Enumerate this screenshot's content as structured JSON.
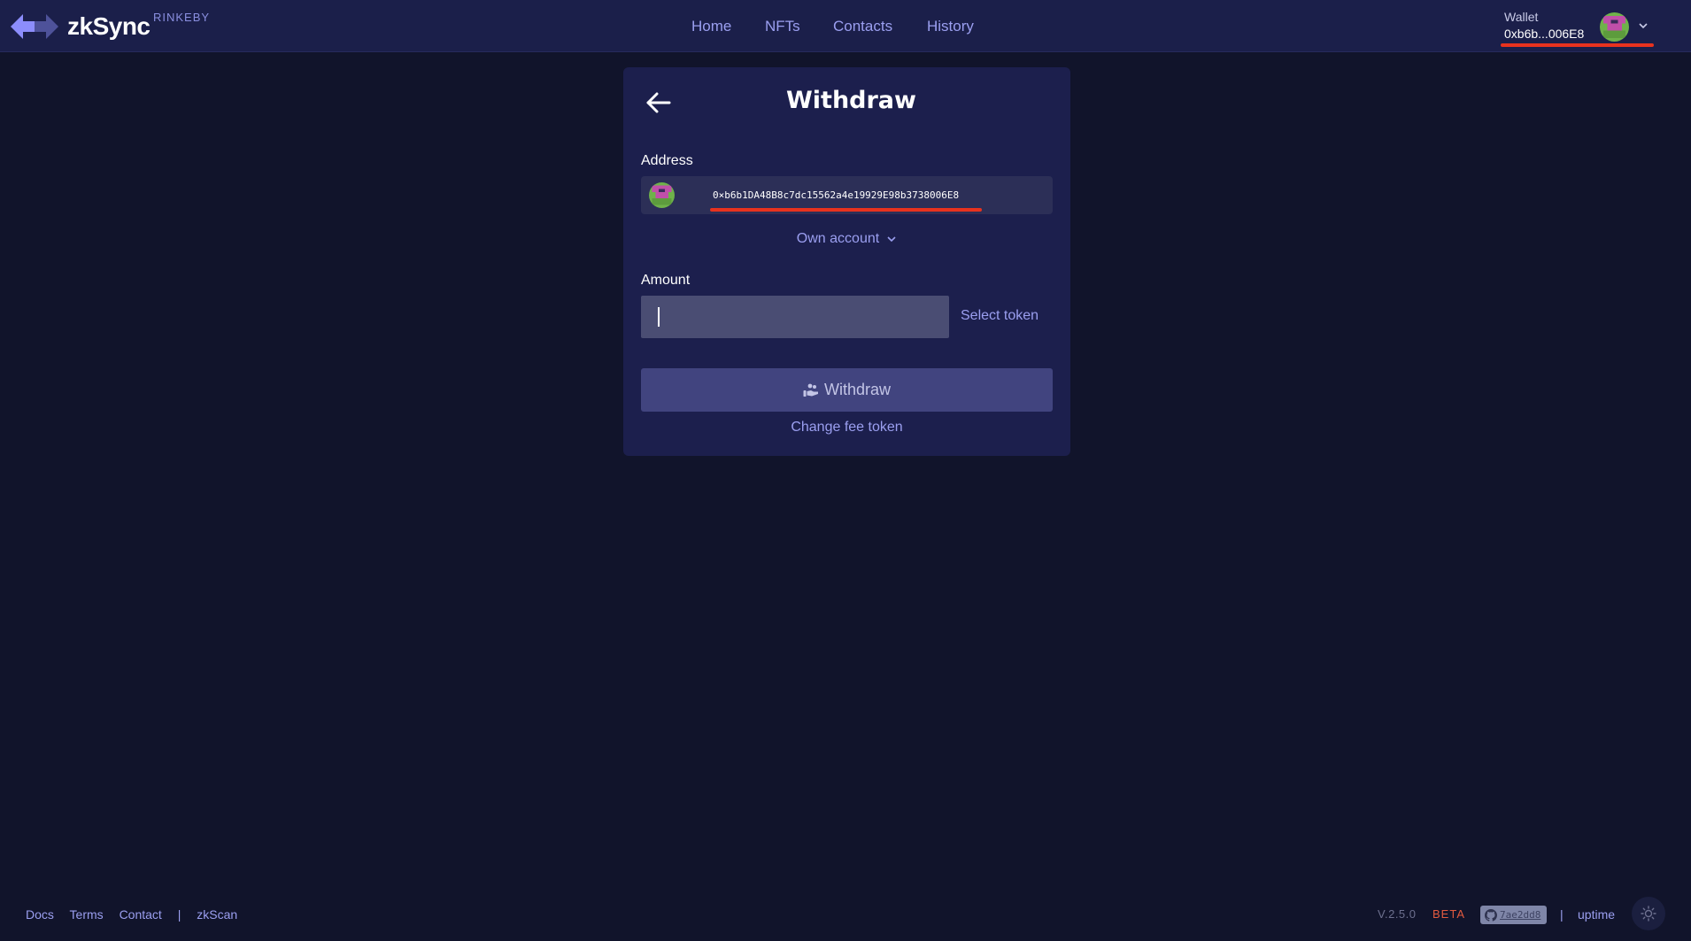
{
  "header": {
    "logo_text": "zkSync",
    "network": "RINKEBY",
    "nav": [
      {
        "label": "Home"
      },
      {
        "label": "NFTs"
      },
      {
        "label": "Contacts"
      },
      {
        "label": "History"
      }
    ],
    "wallet_label": "Wallet",
    "wallet_address": "0xb6b...006E8"
  },
  "withdraw": {
    "title": "Withdraw",
    "address_label": "Address",
    "address_value": "0×b6b1DA48B8c7dc15562a4e19929E98b3738006E8",
    "own_account": "Own account",
    "amount_label": "Amount",
    "amount_value": "",
    "select_token": "Select token",
    "submit_label": "Withdraw",
    "change_fee_token": "Change fee token"
  },
  "footer": {
    "links": [
      {
        "label": "Docs"
      },
      {
        "label": "Terms"
      },
      {
        "label": "Contact"
      }
    ],
    "separator": "|",
    "zkscan": "zkScan",
    "version": "V.2.5.0",
    "beta": "BETA",
    "commit": "7ae2dd8",
    "uptime": "uptime"
  },
  "colors": {
    "background": "#11142b",
    "header": "#1b1f4a",
    "card": "#1c1f4d",
    "accent": "#9b9ff0",
    "highlight": "#e8321e",
    "beta": "#e25a3f"
  },
  "icons": {
    "back": "arrow-left-icon",
    "own_account": "chevron-down-icon",
    "withdraw": "hand-coins-icon",
    "commit": "github-icon",
    "theme": "sun-icon"
  }
}
